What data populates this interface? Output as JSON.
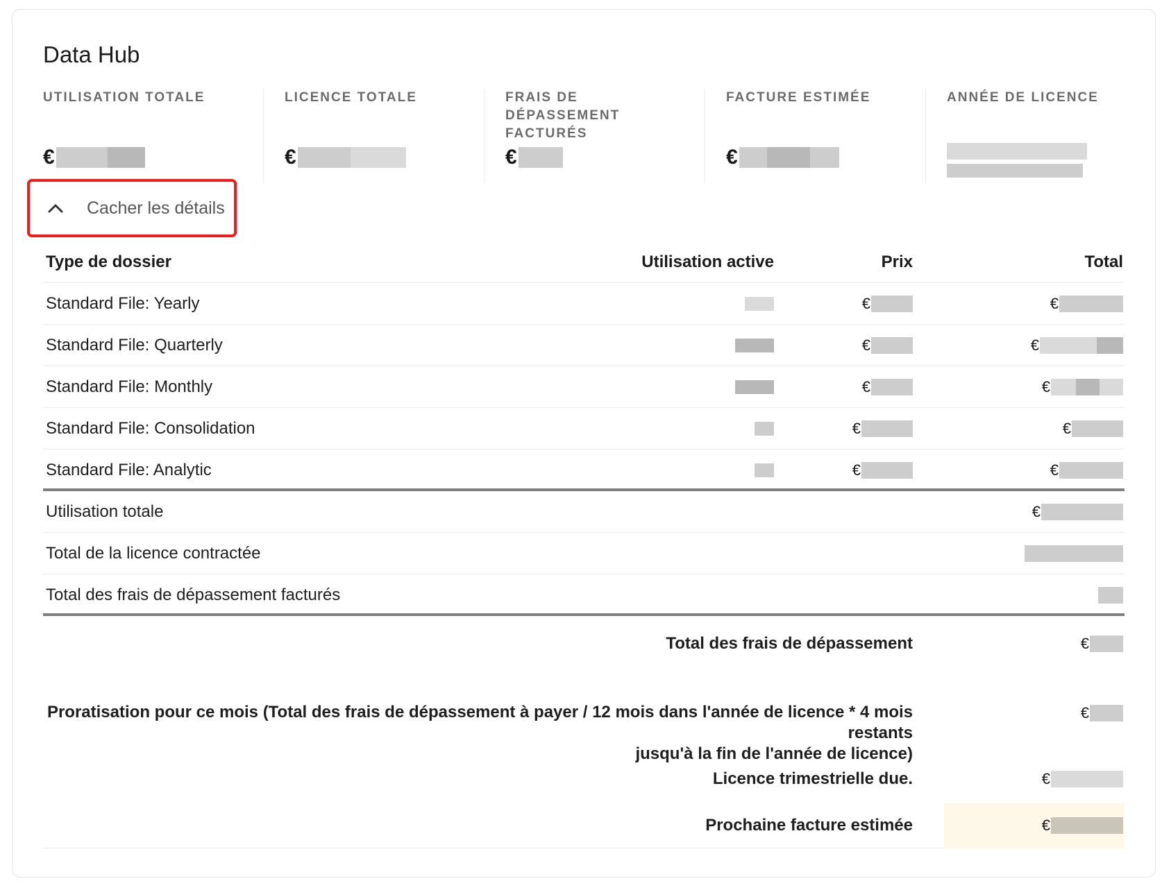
{
  "title": "Data Hub",
  "stats": [
    {
      "label": "UTILISATION TOTALE",
      "currency": "€"
    },
    {
      "label": "LICENCE TOTALE",
      "currency": "€"
    },
    {
      "label": "FRAIS DE DÉPASSEMENT FACTURÉS",
      "currency": "€"
    },
    {
      "label": "FACTURE ESTIMÉE",
      "currency": "€"
    },
    {
      "label": "ANNÉE DE LICENCE",
      "currency": ""
    }
  ],
  "toggle": {
    "label": "Cacher les détails",
    "icon": "chevron-up-icon"
  },
  "table": {
    "headers": {
      "name": "Type de dossier",
      "active": "Utilisation active",
      "price": "Prix",
      "total": "Total"
    },
    "rows": [
      {
        "name": "Standard File: Yearly",
        "currency": "€"
      },
      {
        "name": "Standard File: Quarterly",
        "currency": "€"
      },
      {
        "name": "Standard File: Monthly",
        "currency": "€"
      },
      {
        "name": "Standard File: Consolidation",
        "currency": "€"
      },
      {
        "name": "Standard File: Analytic",
        "currency": "€"
      }
    ]
  },
  "totals": [
    {
      "label": "Utilisation totale",
      "currency": "€"
    },
    {
      "label": "Total de la licence contractée",
      "currency": ""
    },
    {
      "label": "Total des frais de dépassement facturés",
      "currency": ""
    }
  ],
  "summary": {
    "overage_total": {
      "label": "Total des frais de dépassement",
      "currency": "€"
    },
    "proration": {
      "line1": "Proratisation pour ce mois (Total des frais de dépassement à payer / 12 mois dans l'année de licence * 4 mois restants",
      "line2": "jusqu'à la fin de l'année de licence)",
      "currency": "€"
    },
    "quarterly": {
      "label": "Licence trimestrielle due.",
      "currency": "€"
    },
    "next_invoice": {
      "label": "Prochaine facture estimée",
      "currency": "€"
    }
  },
  "colors": {
    "highlight_border": "#f21a1a",
    "row_highlight": "#fdf8e8",
    "divider": "#7f7f7f"
  }
}
